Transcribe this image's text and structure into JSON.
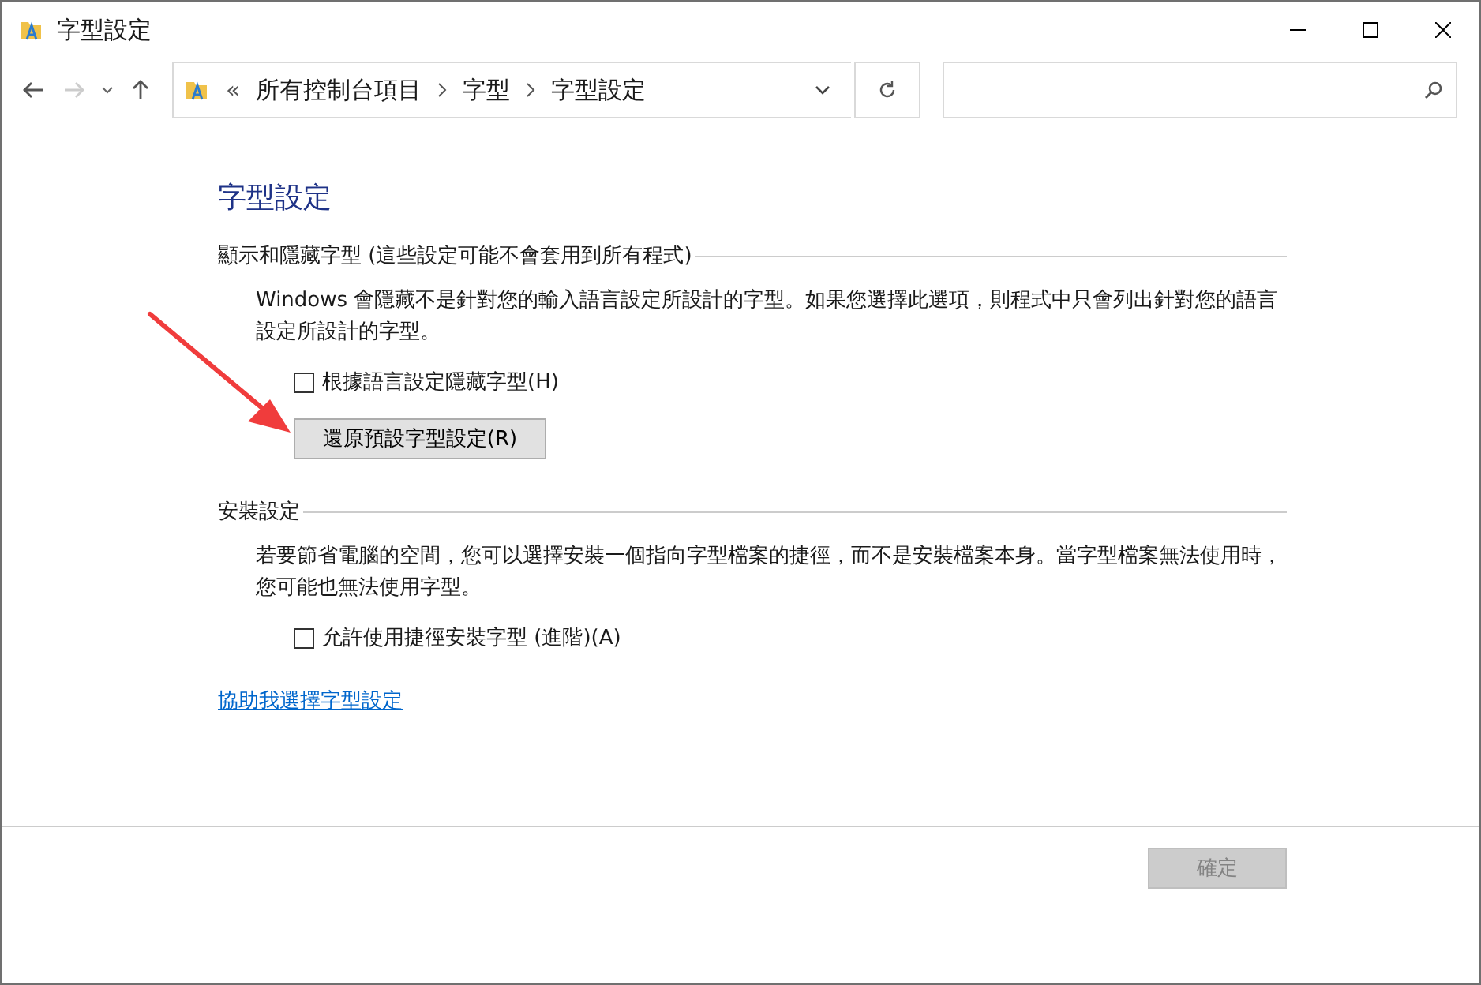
{
  "window": {
    "title": "字型設定"
  },
  "nav": {
    "back_disabled": false,
    "forward_disabled": true
  },
  "address": {
    "overflow": "«",
    "crumbs": [
      "所有控制台項目",
      "字型",
      "字型設定"
    ]
  },
  "page_title": "字型設定",
  "sections": [
    {
      "heading": "顯示和隱藏字型 (這些設定可能不會套用到所有程式)",
      "text": "Windows 會隱藏不是針對您的輸入語言設定所設計的字型。如果您選擇此選項，則程式中只會列出針對您的語言設定所設計的字型。",
      "checkbox": {
        "label": "根據語言設定隱藏字型(H)",
        "checked": false
      },
      "button": "還原預設字型設定(R)"
    },
    {
      "heading": "安裝設定",
      "text": "若要節省電腦的空間，您可以選擇安裝一個指向字型檔案的捷徑，而不是安裝檔案本身。當字型檔案無法使用時，您可能也無法使用字型。",
      "checkbox": {
        "label": "允許使用捷徑安裝字型 (進階)(A)",
        "checked": false
      }
    }
  ],
  "help_link": "協助我選擇字型設定",
  "ok_button": {
    "label": "確定",
    "disabled": true
  },
  "annotation": {
    "kind": "arrow"
  }
}
